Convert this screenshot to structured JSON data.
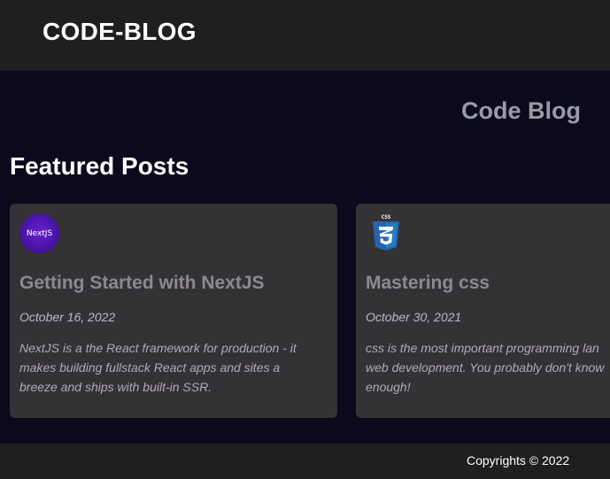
{
  "header": {
    "logo": "CODE-BLOG"
  },
  "hero": {
    "title": "Code Blog"
  },
  "featured": {
    "title": "Featured Posts",
    "posts": [
      {
        "thumbnail": "nextjs-logo",
        "thumbnail_text": "NextJS",
        "title": "Getting Started with NextJS",
        "date": "October 16, 2022",
        "excerpt": "NextJS is a the React framework for production - it makes building fullstack React apps and sites a breeze and ships with built-in SSR."
      },
      {
        "thumbnail": "css3-logo",
        "thumbnail_text": "CSS",
        "title": "Mastering css",
        "date": "October 30, 2021",
        "excerpt_lines": [
          "css is the most important programming lan",
          "web development. You probably don't know",
          "enough!"
        ]
      }
    ]
  },
  "footer": {
    "copyright": "Copyrights © 2022"
  },
  "colors": {
    "header_bg": "#1f1e21",
    "page_bg": "#0a0a1c",
    "card_bg": "#353236",
    "nextjs_purple": "#5a1bc0",
    "css_blue": "#2565ae"
  }
}
